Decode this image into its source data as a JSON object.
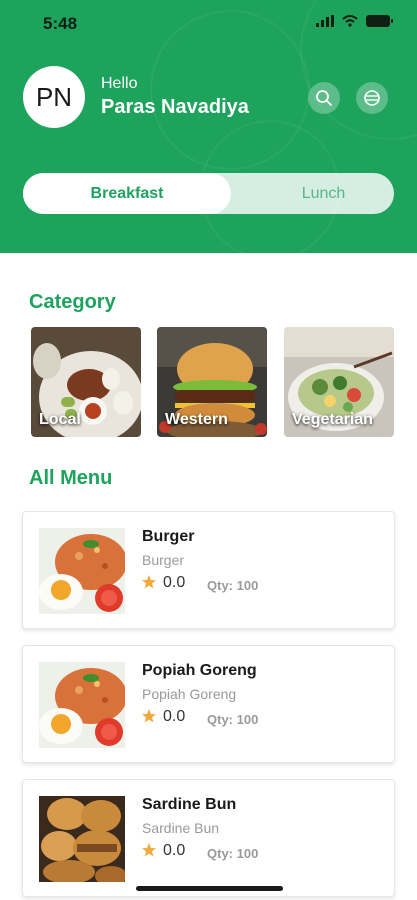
{
  "status_bar": {
    "time": "5:48"
  },
  "user": {
    "initials": "PN",
    "greeting": "Hello",
    "name": "Paras Navadiya"
  },
  "header_actions": [
    "search-icon",
    "logout-icon"
  ],
  "meal_toggle": {
    "active": "Breakfast",
    "inactive": "Lunch"
  },
  "category": {
    "title": "Category",
    "items": [
      {
        "label": "Local"
      },
      {
        "label": "Western"
      },
      {
        "label": "Vegetarian"
      }
    ]
  },
  "menu": {
    "title": "All Menu",
    "items": [
      {
        "name": "Burger",
        "subtitle": "Burger",
        "rating": "0.0",
        "qty": "Qty: 100"
      },
      {
        "name": "Popiah Goreng",
        "subtitle": "Popiah Goreng",
        "rating": "0.0",
        "qty": "Qty: 100"
      },
      {
        "name": "Sardine Bun",
        "subtitle": "Sardine Bun",
        "rating": "0.0",
        "qty": "Qty: 100"
      }
    ]
  },
  "colors": {
    "brand": "#1ea35d",
    "star": "#f2a93b",
    "text_muted": "#9a9a9a"
  }
}
